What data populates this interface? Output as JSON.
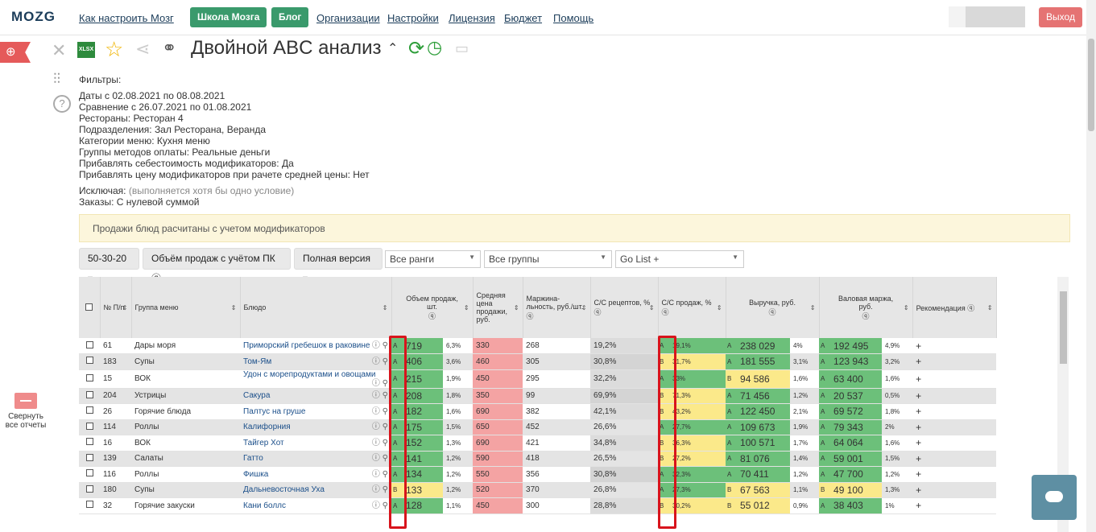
{
  "nav": {
    "logo": "MOZG",
    "links": [
      "Как настроить Мозг",
      "Организации",
      "Настройки",
      "Лицензия",
      "Бюджет",
      "Помощь"
    ],
    "school_btn": "Школа Мозга",
    "blog_btn": "Блог",
    "exit_btn": "Выход"
  },
  "collapse_label": "Свернуть все отчеты",
  "report": {
    "title": "Двойной ABC анализ",
    "xlsx": "XLSX"
  },
  "filters": {
    "heading": "Фильтры:",
    "lines": [
      "Даты с 02.08.2021 по 08.08.2021",
      "Сравнение с 26.07.2021 по 01.08.2021",
      "Рестораны: Ресторан 4",
      "Подразделения: Зал Ресторана, Веранда",
      "Категории меню: Кухня меню",
      "Группы методов оплаты: Реальные деньги",
      "Прибавлять себестоимость модификаторов: Да",
      "Прибавлять цену модификаторов при рачете средней цены: Нет"
    ],
    "exclude_label": "Исключая:",
    "exclude_note": "(выполняется хотя бы одно условие)",
    "orders_line": "Заказы: С нулевой суммой"
  },
  "notice": "Продажи блюд расчитаны с учетом модификаторов",
  "toolbar": {
    "ratio": "50-30-20",
    "volume": "Объём продаж с учётом ПК",
    "version": "Полная версия",
    "ranks": "Все ранги",
    "groups": "Все группы",
    "golist": "Go List +"
  },
  "columns": {
    "num": "№ П/п",
    "group": "Группа меню",
    "dish": "Блюдо",
    "volume": "Объем продаж, шт.",
    "avg_price": "Средняя цена продажи, руб.",
    "margin": "Маржина-льность, руб./шт.",
    "cost_recipes": "С/С рецептов, %",
    "cost_sales": "С/С продаж, %",
    "revenue": "Выручка, руб.",
    "gross": "Валовая маржа, руб.",
    "recommend": "Рекомендация"
  },
  "rows": [
    {
      "n": "61",
      "group": "Дары моря",
      "dish": "Приморский гребешок в раковине",
      "vr": "A",
      "vol": "719",
      "vp": "6,3%",
      "price": "330",
      "margin": "268",
      "csr": "19,2%",
      "csr_c": "w",
      "csr2": "A",
      "cs": "19,1%",
      "rr": "A",
      "rev": "238 029",
      "revp": "4%",
      "gr": "A",
      "gm": "192 495",
      "gmp": "4,9%",
      "rec": "+"
    },
    {
      "n": "183",
      "group": "Супы",
      "dish": "Том-Ям",
      "vr": "A",
      "vol": "406",
      "vp": "3,6%",
      "price": "460",
      "margin": "305",
      "csr": "30,8%",
      "csr_c": "g",
      "csr2": "B",
      "cs": "31,7%",
      "rr": "A",
      "rev": "181 555",
      "revp": "3,1%",
      "gr": "A",
      "gm": "123 943",
      "gmp": "3,2%",
      "rec": "+"
    },
    {
      "n": "15",
      "group": "ВОК",
      "dish": "Удон с морепродуктами и овощами",
      "vr": "A",
      "vol": "215",
      "vp": "1,9%",
      "price": "450",
      "margin": "295",
      "csr": "32,2%",
      "csr_c": "w",
      "csr2": "A",
      "cs": "33%",
      "rr": "B",
      "rev": "94 586",
      "revp": "1,6%",
      "gr": "A",
      "gm": "63 400",
      "gmp": "1,6%",
      "rec": "+"
    },
    {
      "n": "204",
      "group": "Устрицы",
      "dish": "Сакура",
      "vr": "A",
      "vol": "208",
      "vp": "1,8%",
      "price": "350",
      "margin": "99",
      "csr": "69,9%",
      "csr_c": "g",
      "csr2": "B",
      "cs": "71,3%",
      "rr": "A",
      "rev": "71 456",
      "revp": "1,2%",
      "gr": "A",
      "gm": "20 537",
      "gmp": "0,5%",
      "rec": "+"
    },
    {
      "n": "26",
      "group": "Горячие блюда",
      "dish": "Палтус на груше",
      "vr": "A",
      "vol": "182",
      "vp": "1,6%",
      "price": "690",
      "margin": "382",
      "csr": "42,1%",
      "csr_c": "w",
      "csr2": "B",
      "cs": "43,2%",
      "rr": "A",
      "rev": "122 450",
      "revp": "2,1%",
      "gr": "A",
      "gm": "69 572",
      "gmp": "1,8%",
      "rec": "+"
    },
    {
      "n": "114",
      "group": "Роллы",
      "dish": "Калифорния",
      "vr": "A",
      "vol": "175",
      "vp": "1,5%",
      "price": "650",
      "margin": "452",
      "csr": "26,6%",
      "csr_c": "w",
      "csr2": "A",
      "cs": "27,7%",
      "rr": "A",
      "rev": "109 673",
      "revp": "1,9%",
      "gr": "A",
      "gm": "79 343",
      "gmp": "2%",
      "rec": "+"
    },
    {
      "n": "16",
      "group": "ВОК",
      "dish": "Тайгер Хот",
      "vr": "A",
      "vol": "152",
      "vp": "1,3%",
      "price": "690",
      "margin": "421",
      "csr": "34,8%",
      "csr_c": "w",
      "csr2": "B",
      "cs": "36,3%",
      "rr": "A",
      "rev": "100 571",
      "revp": "1,7%",
      "gr": "A",
      "gm": "64 064",
      "gmp": "1,6%",
      "rec": "+"
    },
    {
      "n": "139",
      "group": "Салаты",
      "dish": "Гатто",
      "vr": "A",
      "vol": "141",
      "vp": "1,2%",
      "price": "590",
      "margin": "418",
      "csr": "26,5%",
      "csr_c": "w",
      "csr2": "B",
      "cs": "27,2%",
      "rr": "A",
      "rev": "81 076",
      "revp": "1,4%",
      "gr": "A",
      "gm": "59 001",
      "gmp": "1,5%",
      "rec": "+"
    },
    {
      "n": "116",
      "group": "Роллы",
      "dish": "Фишка",
      "vr": "A",
      "vol": "134",
      "vp": "1,2%",
      "price": "550",
      "margin": "356",
      "csr": "30,8%",
      "csr_c": "g",
      "csr2": "A",
      "cs": "32,3%",
      "rr": "A",
      "rev": "70 411",
      "revp": "1,2%",
      "gr": "A",
      "gm": "47 700",
      "gmp": "1,2%",
      "rec": "+"
    },
    {
      "n": "180",
      "group": "Супы",
      "dish": "Дальневосточная Уха",
      "vr": "B",
      "vol": "133",
      "vp": "1,2%",
      "price": "520",
      "margin": "370",
      "csr": "26,8%",
      "csr_c": "w",
      "csr2": "A",
      "cs": "27,3%",
      "rr": "B",
      "rev": "67 563",
      "revp": "1,1%",
      "gr": "B",
      "gm": "49 100",
      "gmp": "1,3%",
      "rec": "+"
    },
    {
      "n": "32",
      "group": "Горячие закуски",
      "dish": "Кани боллс",
      "vr": "A",
      "vol": "128",
      "vp": "1,1%",
      "price": "450",
      "margin": "300",
      "csr": "28,8%",
      "csr_c": "w",
      "csr2": "B",
      "cs": "30,2%",
      "rr": "B",
      "rev": "55 012",
      "revp": "0,9%",
      "gr": "A",
      "gm": "38 403",
      "gmp": "1%",
      "rec": "+"
    }
  ]
}
